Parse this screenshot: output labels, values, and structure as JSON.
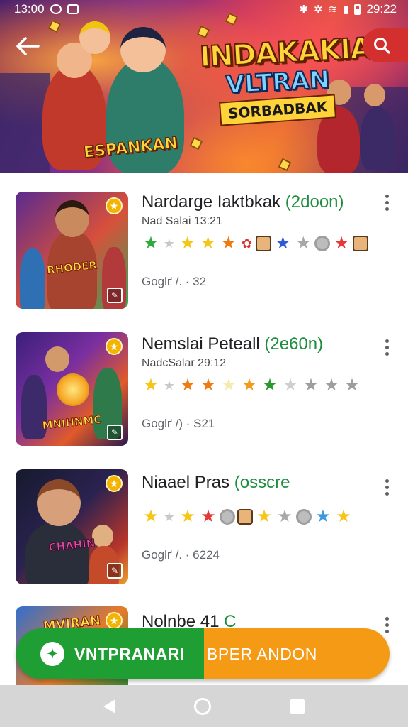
{
  "status_bar": {
    "time_left": "13:00",
    "time_right": "29:22"
  },
  "banner": {
    "logo_line1": "INDAKAKIA",
    "logo_line2": "VLTRAN",
    "logo_line3": "SORBADBAK",
    "left_logo": "ESPANKAN"
  },
  "list": {
    "items": [
      {
        "title": "Nardarge Iaktbkak",
        "tag": "(2doon)",
        "subtitle": "Nad Salai 13:21",
        "meta": "Goglґ /. · 32",
        "thumb_title": "RHODER",
        "icons": [
          "star-green",
          "star-gray",
          "star-yellow",
          "star-yellow",
          "star-orange",
          "star-red",
          "face",
          "star-blue",
          "star-gray",
          "gear",
          "star-red",
          "face"
        ]
      },
      {
        "title": "Nemslai Peteall",
        "tag": "(2e60n)",
        "subtitle": "NadcSalar 29:12",
        "meta": "Goglґ /) · S21",
        "thumb_title": "MNIHNMC",
        "icons": [
          "star-yellow",
          "star-gray",
          "star-orange",
          "star-orange",
          "star-light",
          "star-orange",
          "star-green",
          "star-gray",
          "star-gray",
          "star-gray",
          "star-gray"
        ]
      },
      {
        "title": "Niaael Pras",
        "tag": "(osscre",
        "subtitle": "",
        "meta": "Goglґ /. · 6224",
        "thumb_title": "CHAHIN",
        "icons": [
          "star-green",
          "star-gray",
          "star-yellow",
          "star-red",
          "gear",
          "face",
          "star-yellow",
          "star-gray",
          "gear",
          "star-blue",
          "star-yellow"
        ]
      },
      {
        "title": "Nolnbe 41",
        "tag": "C",
        "subtitle": "",
        "meta": "",
        "thumb_title": "MVIRAN",
        "icons": []
      }
    ]
  },
  "cta": {
    "left_label": "VNTPRANARI",
    "right_label": "BPER ANDON"
  },
  "colors": {
    "accent_green": "#1f9e33",
    "accent_orange": "#f59a14",
    "search_red": "#d32f2f",
    "tag_green": "#1e8e3e"
  }
}
